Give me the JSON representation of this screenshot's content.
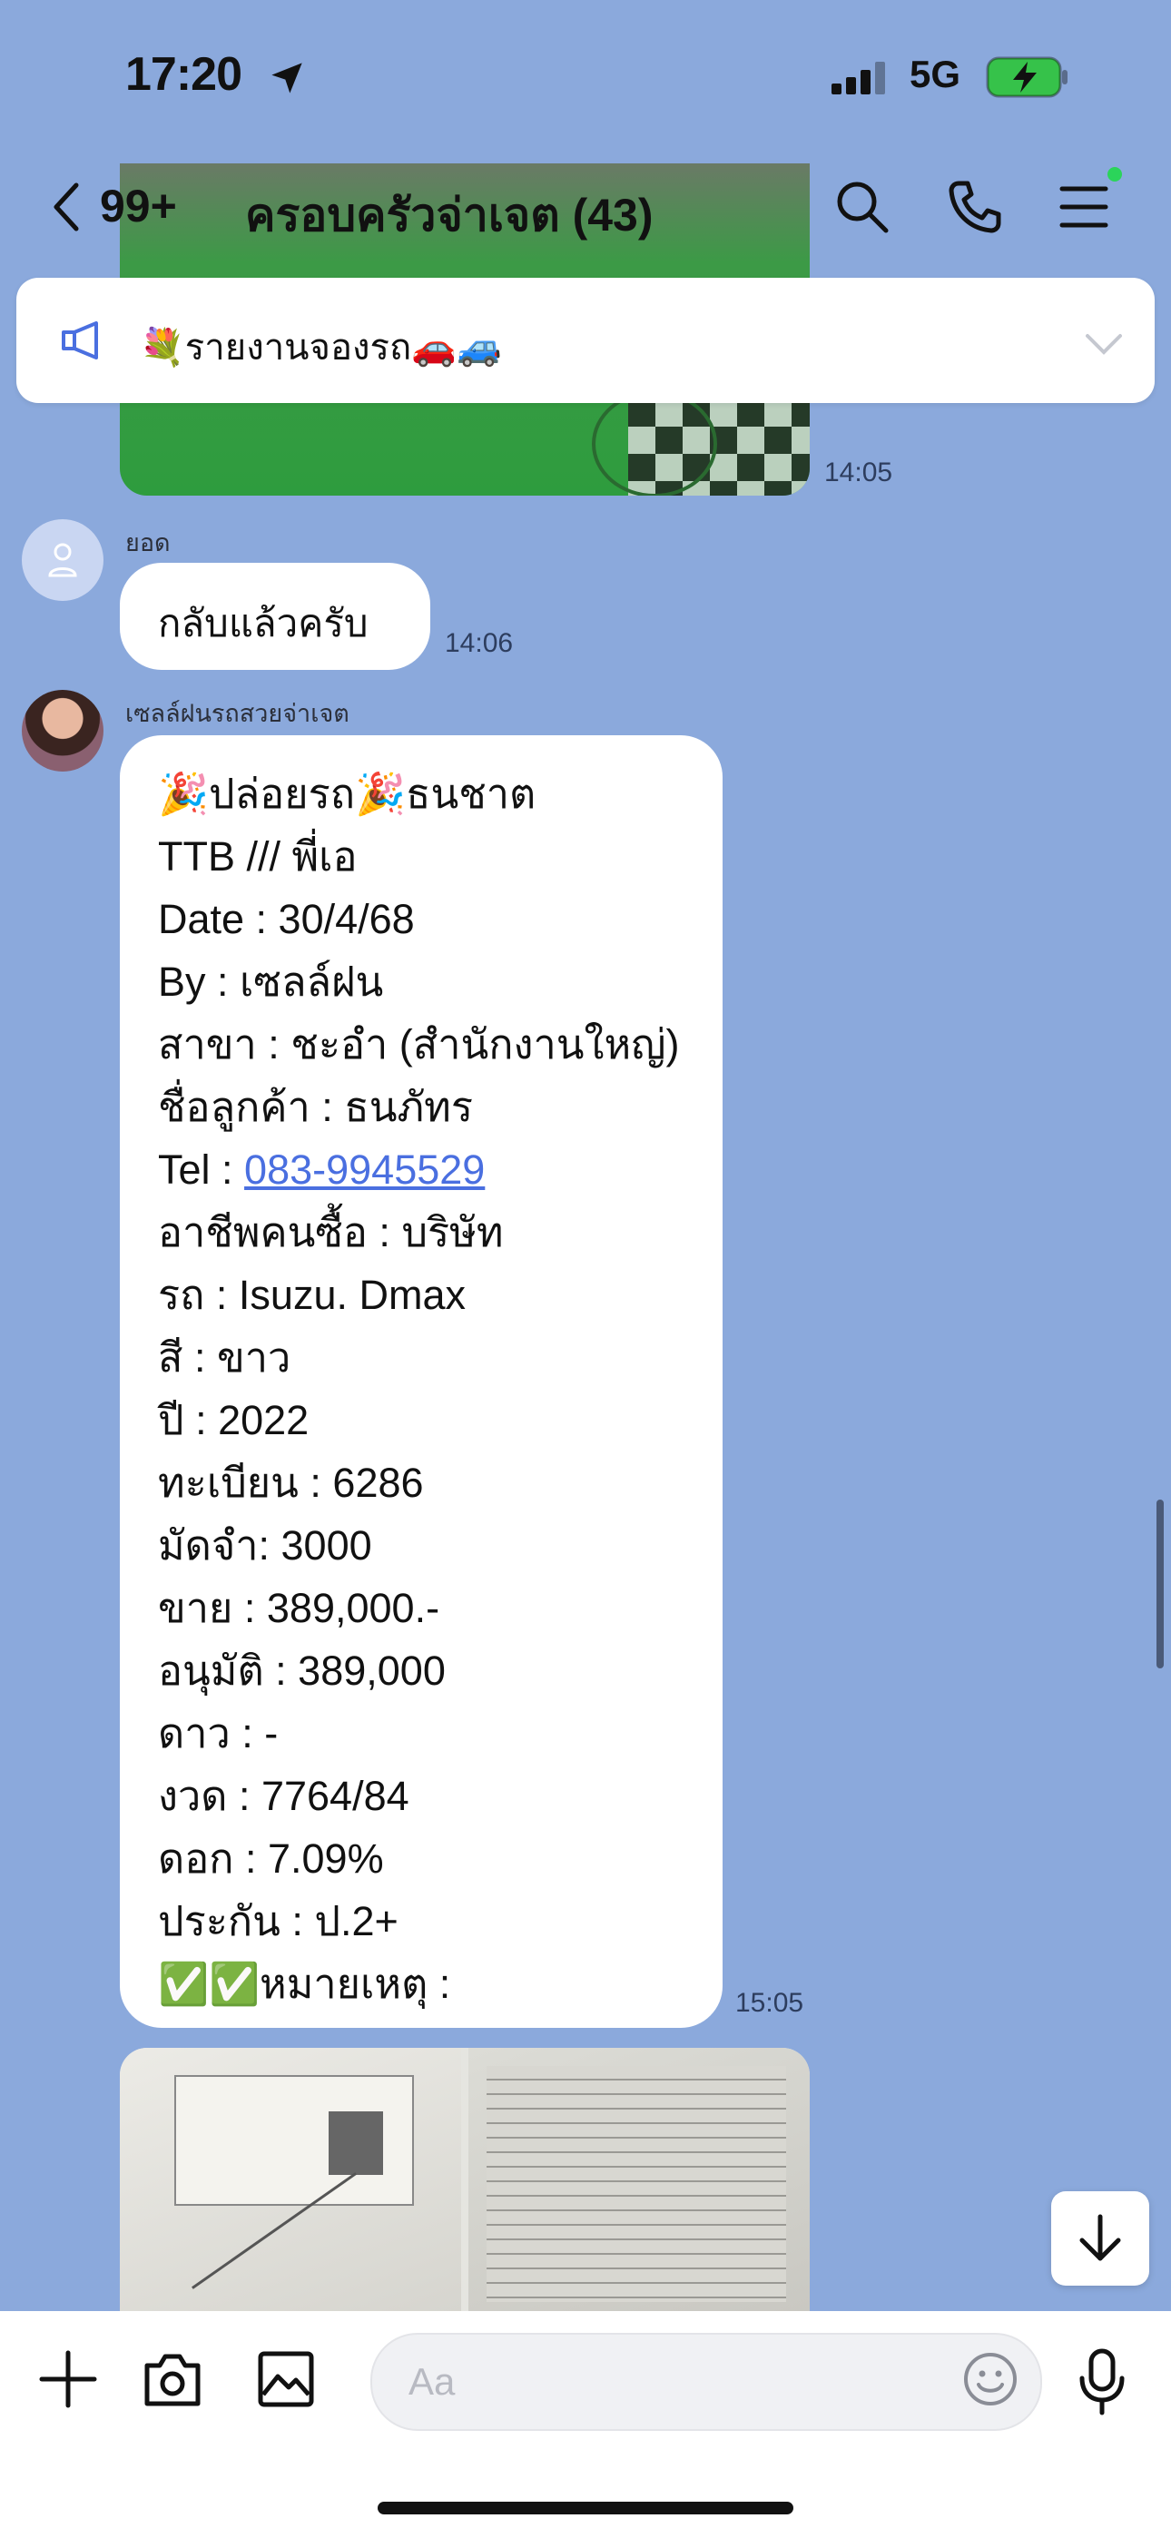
{
  "status_bar": {
    "time": "17:20",
    "network": "5G"
  },
  "header": {
    "back_count": "99+",
    "title": "ครอบครัวจ่าเจต (43)"
  },
  "announcement": {
    "text": "💐รายงานจองรถ🚗🚙"
  },
  "messages": [
    {
      "time": "14:05"
    },
    {
      "sender": "ยอด",
      "text": "กลับแล้วครับ",
      "time": "14:06"
    },
    {
      "sender": "เซลล์ฝนรถสวยจ่าเจต",
      "time": "15:05",
      "lines": [
        "🎉ปล่อยรถ🎉ธนชาต",
        "TTB /// พี่เอ",
        "Date : 30/4/68",
        "By : เซลล์ฝน",
        "สาขา : ชะอำ (สำนักงานใหญ่)",
        "ชื่อลูกค้า : ธนภัทร",
        "Tel : ",
        "อาชีพคนซื้อ : บริษัท",
        "รถ : Isuzu. Dmax",
        "สี : ขาว",
        "ปี : 2022",
        "ทะเบียน : 6286",
        "มัดจำ: 3000",
        "ขาย : 389,000.-",
        "อนุมัติ : 389,000",
        "ดาว : -",
        "งวด : 7764/84",
        "ดอก : 7.09%",
        "ประกัน :  ป.2+",
        "✅✅หมายเหตุ :"
      ],
      "phone": "083-9945529"
    }
  ],
  "input": {
    "placeholder": "Aa"
  },
  "icons": [
    "location-arrow-icon",
    "signal-icon",
    "battery-icon",
    "back-chevron-icon",
    "search-icon",
    "call-icon",
    "menu-icon",
    "megaphone-icon",
    "chevron-down-icon",
    "user-icon",
    "arrow-down-icon",
    "plus-icon",
    "camera-icon",
    "image-icon",
    "emoji-icon",
    "mic-icon"
  ]
}
